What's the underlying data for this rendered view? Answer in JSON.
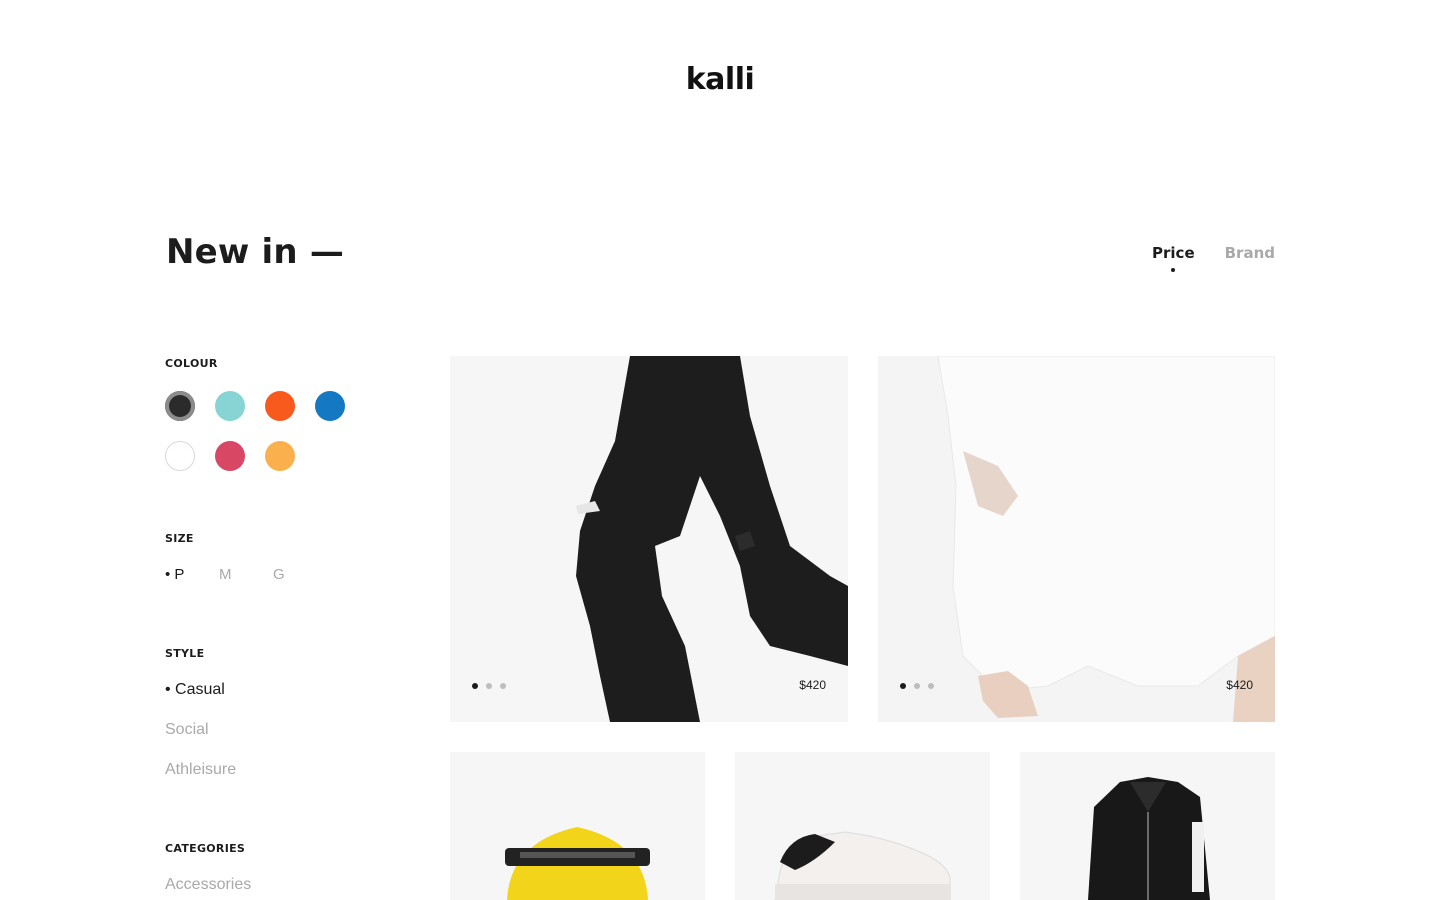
{
  "brand": {
    "logo_text": "kalli"
  },
  "header": {
    "title": "New in —",
    "sort_tabs": [
      {
        "label": "Price",
        "active": true
      },
      {
        "label": "Brand",
        "active": false
      }
    ]
  },
  "filters": {
    "colour": {
      "heading": "COLOUR",
      "swatches": [
        {
          "name": "black",
          "color": "#2b2b2b",
          "selected": true
        },
        {
          "name": "aqua",
          "color": "#86d4d4",
          "selected": false
        },
        {
          "name": "orange",
          "color": "#f75a1c",
          "selected": false
        },
        {
          "name": "blue",
          "color": "#1479c2",
          "selected": false
        },
        {
          "name": "white",
          "color": "#ffffff",
          "selected": false
        },
        {
          "name": "pink",
          "color": "#d84864",
          "selected": false
        },
        {
          "name": "amber",
          "color": "#fbb04e",
          "selected": false
        }
      ]
    },
    "size": {
      "heading": "SIZE",
      "options": [
        {
          "label": "P",
          "active": true
        },
        {
          "label": "M",
          "active": false
        },
        {
          "label": "G",
          "active": false
        }
      ]
    },
    "style": {
      "heading": "STYLE",
      "options": [
        {
          "label": "Casual",
          "active": true
        },
        {
          "label": "Social",
          "active": false
        },
        {
          "label": "Athleisure",
          "active": false
        }
      ]
    },
    "categories": {
      "heading": "CATEGORIES",
      "options": [
        {
          "label": "Accessories",
          "active": false
        }
      ]
    }
  },
  "products": [
    {
      "name": "black-ripped-jeans",
      "price": "$420",
      "image_count": 3,
      "active_image": 0
    },
    {
      "name": "white-distressed-sweater",
      "price": "$420",
      "image_count": 3,
      "active_image": 0
    },
    {
      "name": "yellow-visor",
      "price": "",
      "image_count": 0,
      "active_image": 0
    },
    {
      "name": "white-sneaker",
      "price": "",
      "image_count": 0,
      "active_image": 0
    },
    {
      "name": "black-leather-jacket",
      "price": "",
      "image_count": 0,
      "active_image": 0
    }
  ],
  "colors": {
    "text": "#1c1c1c",
    "muted": "#a9a9a9",
    "card_bg": "#f6f6f6"
  }
}
